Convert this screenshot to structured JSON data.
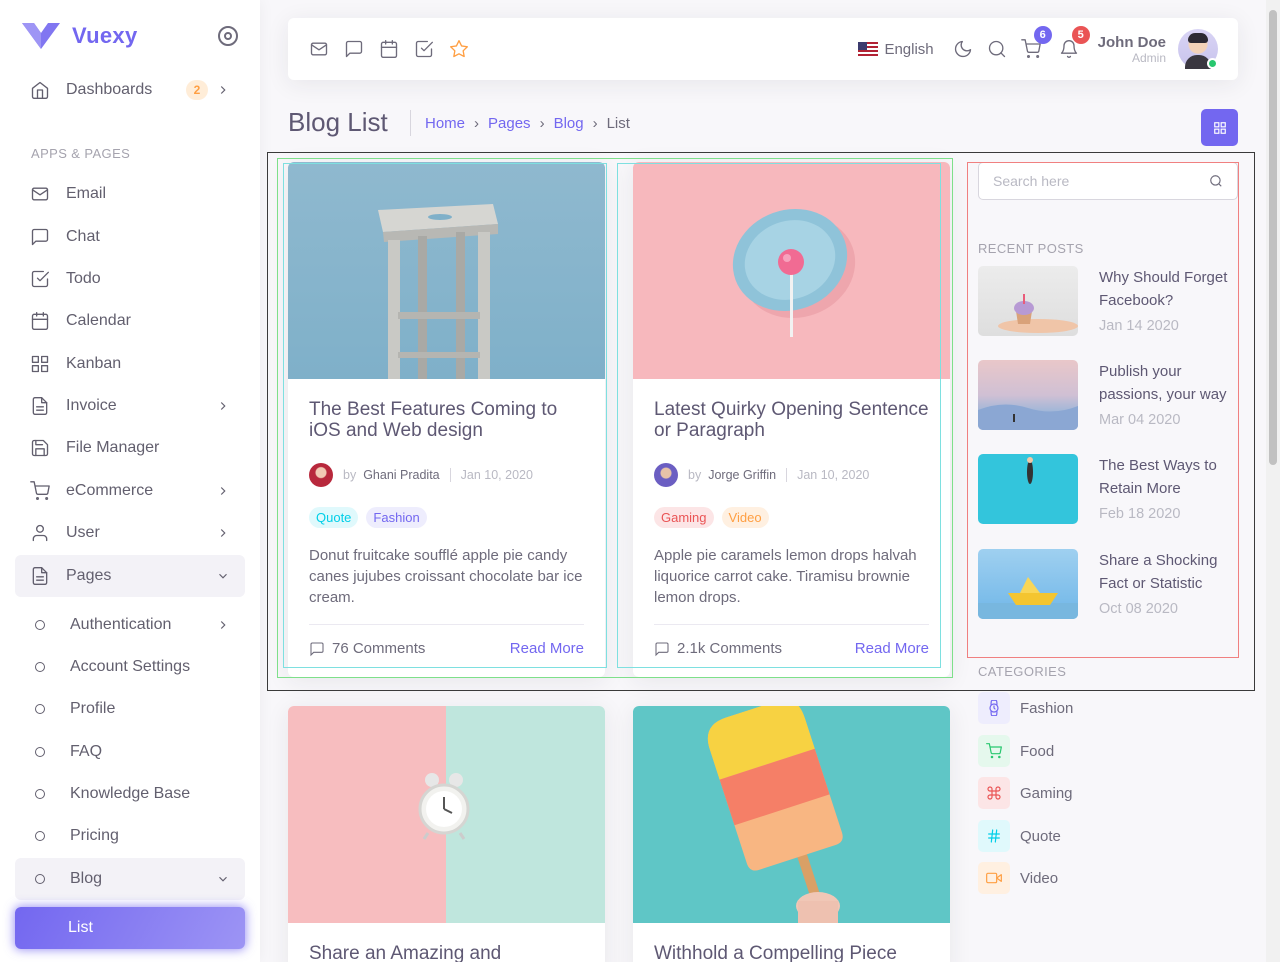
{
  "brand": {
    "name": "Vuexy"
  },
  "sidebar": {
    "dashboards": {
      "label": "Dashboards",
      "badge": "2"
    },
    "section_title": "APPS & PAGES",
    "items": [
      {
        "label": "Email"
      },
      {
        "label": "Chat"
      },
      {
        "label": "Todo"
      },
      {
        "label": "Calendar"
      },
      {
        "label": "Kanban"
      },
      {
        "label": "Invoice"
      },
      {
        "label": "File Manager"
      },
      {
        "label": "eCommerce"
      },
      {
        "label": "User"
      },
      {
        "label": "Pages"
      }
    ],
    "pages_sub": [
      {
        "label": "Authentication"
      },
      {
        "label": "Account Settings"
      },
      {
        "label": "Profile"
      },
      {
        "label": "FAQ"
      },
      {
        "label": "Knowledge Base"
      },
      {
        "label": "Pricing"
      },
      {
        "label": "Blog"
      }
    ],
    "active": {
      "label": "List"
    }
  },
  "navbar": {
    "language": "English",
    "cart_count": "6",
    "notif_count": "5",
    "user_name": "John Doe",
    "user_role": "Admin"
  },
  "page": {
    "title": "Blog List",
    "breadcrumb": [
      "Home",
      "Pages",
      "Blog",
      "List"
    ]
  },
  "posts": [
    {
      "title": "The Best Features Coming to iOS and Web design",
      "by": "by",
      "author": "Ghani Pradita",
      "date": "Jan 10, 2020",
      "tags": [
        "Quote",
        "Fashion"
      ],
      "excerpt": "Donut fruitcake soufflé apple pie candy canes jujubes croissant chocolate bar ice cream.",
      "comments": "76 Comments",
      "read_more": "Read More"
    },
    {
      "title": "Latest Quirky Opening Sentence or Paragraph",
      "by": "by",
      "author": "Jorge Griffin",
      "date": "Jan 10, 2020",
      "tags": [
        "Gaming",
        "Video"
      ],
      "excerpt": "Apple pie caramels lemon drops halvah liquorice carrot cake. Tiramisu brownie lemon drops.",
      "comments": "2.1k Comments",
      "read_more": "Read More"
    },
    {
      "title": "Share an Amazing and"
    },
    {
      "title": "Withhold a Compelling Piece"
    }
  ],
  "search": {
    "placeholder": "Search here"
  },
  "recent": {
    "heading": "RECENT POSTS",
    "items": [
      {
        "title": "Why Should Forget Facebook?",
        "date": "Jan 14 2020"
      },
      {
        "title": "Publish your passions, your way",
        "date": "Mar 04 2020"
      },
      {
        "title": "The Best Ways to Retain More",
        "date": "Feb 18 2020"
      },
      {
        "title": "Share a Shocking Fact or Statistic",
        "date": "Oct 08 2020"
      }
    ]
  },
  "categories": {
    "heading": "CATEGORIES",
    "items": [
      {
        "label": "Fashion",
        "icon": "watch-icon",
        "color": "#7367f0"
      },
      {
        "label": "Food",
        "icon": "cart-icon",
        "color": "#28c76f"
      },
      {
        "label": "Gaming",
        "icon": "command-icon",
        "color": "#ea5455"
      },
      {
        "label": "Quote",
        "icon": "hash-icon",
        "color": "#00cfe8"
      },
      {
        "label": "Video",
        "icon": "video-icon",
        "color": "#ff9f43"
      }
    ]
  },
  "colors": {
    "primary": "#7367f0",
    "success": "#28c76f",
    "danger": "#ea5455",
    "info": "#00cfe8",
    "warning": "#ff9f43"
  }
}
